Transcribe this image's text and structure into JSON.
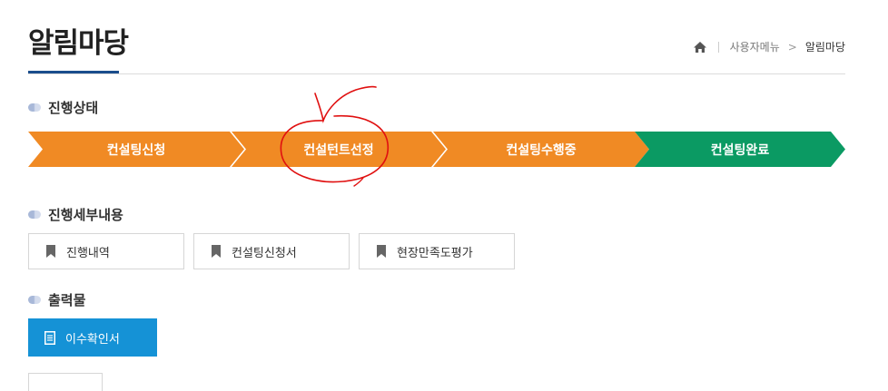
{
  "header": {
    "title": "알림마당"
  },
  "breadcrumb": {
    "home_icon": "home-icon",
    "items": [
      "사용자메뉴",
      "알림마당"
    ]
  },
  "progress": {
    "heading": "진행상태",
    "steps": [
      {
        "label": "컨설팅신청",
        "color": "#f08a24"
      },
      {
        "label": "컨설턴트선정",
        "color": "#f08a24"
      },
      {
        "label": "컨설팅수행중",
        "color": "#f08a24"
      },
      {
        "label": "컨설팅완료",
        "color": "#0b9a63"
      }
    ]
  },
  "details": {
    "heading": "진행세부내용",
    "buttons": [
      {
        "label": "진행내역",
        "icon": "bookmark-icon"
      },
      {
        "label": "컨설팅신청서",
        "icon": "bookmark-icon"
      },
      {
        "label": "현장만족도평가",
        "icon": "bookmark-icon"
      }
    ]
  },
  "outputs": {
    "heading": "출력물",
    "button": {
      "label": "이수확인서",
      "icon": "document-icon",
      "color": "#1592d6"
    }
  },
  "colors": {
    "accent": "#1a4d8c",
    "annotation": "#e01010"
  }
}
